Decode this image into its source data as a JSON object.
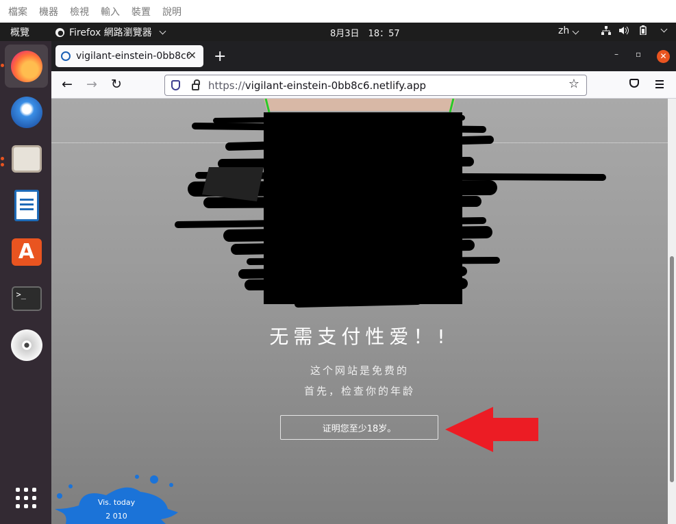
{
  "vm_menu": [
    "檔案",
    "機器",
    "檢視",
    "輸入",
    "裝置",
    "說明"
  ],
  "topbar": {
    "activities": "概覽",
    "app_name": "Firefox 網路瀏覽器",
    "clock": "8月3日　18：57",
    "lang": "zh"
  },
  "dock": [
    "firefox-icon",
    "thunderbird-icon",
    "files-icon",
    "writer-icon",
    "software-icon",
    "terminal-icon",
    "dvd-icon",
    "apps-grid-icon"
  ],
  "browser": {
    "tab_title": "vigilant-einstein-0bb8c6.n",
    "url_scheme": "https://",
    "url_host": "vigilant-einstein-0bb8c6.netlify.app"
  },
  "page": {
    "headline": "无需支付性爱！!",
    "sub1": "这个网站是免费的",
    "sub2": "首先，检查你的年龄",
    "button": "证明您至少18岁。",
    "counter_label": "Vis. today",
    "counter_value": "2 010"
  },
  "colors": {
    "arrow": "#ec1c24",
    "accent": "#e95420"
  }
}
